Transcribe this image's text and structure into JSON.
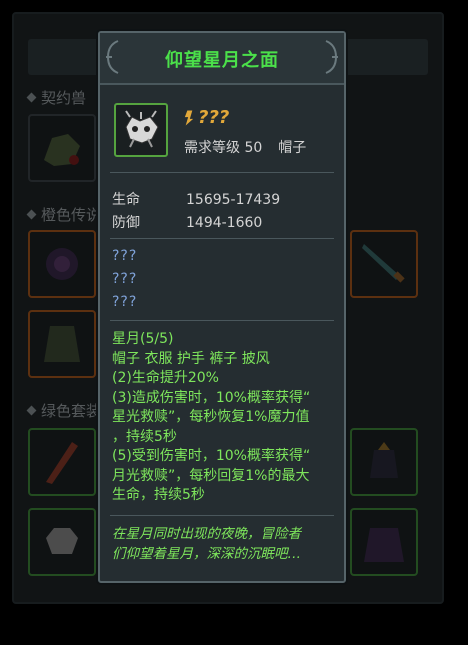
{
  "background": {
    "sections": [
      "契约兽",
      "橙色传说",
      "绿色套装"
    ]
  },
  "tooltip": {
    "title": "仰望星月之面",
    "item_name": "???",
    "level_req": "需求等级 50",
    "slot_type": "帽子",
    "stats": [
      {
        "key": "生命",
        "value": "15695-17439"
      },
      {
        "key": "防御",
        "value": "1494-1660"
      }
    ],
    "unknown_affixes": [
      "???",
      "???",
      "???"
    ],
    "set_lines": [
      "星月(5/5)",
      "帽子 衣服 护手 裤子 披风",
      "(2)生命提升20%",
      "(3)造成伤害时，10%概率获得“",
      "星光救赎”，每秒恢复1%魔力值",
      "，持续5秒",
      "(5)受到伤害时，10%概率获得“",
      "月光救赎”，每秒回复1%的最大",
      "生命，持续5秒"
    ],
    "flavor_lines": [
      "在星月同时出现的夜晚，冒险者",
      "们仰望着星月，深深的沉眠吧…"
    ],
    "colors": {
      "title": "#4be04a",
      "item_name": "#e2a83a",
      "unknown": "#7fa2d8",
      "set_text": "#7ee65c"
    }
  }
}
